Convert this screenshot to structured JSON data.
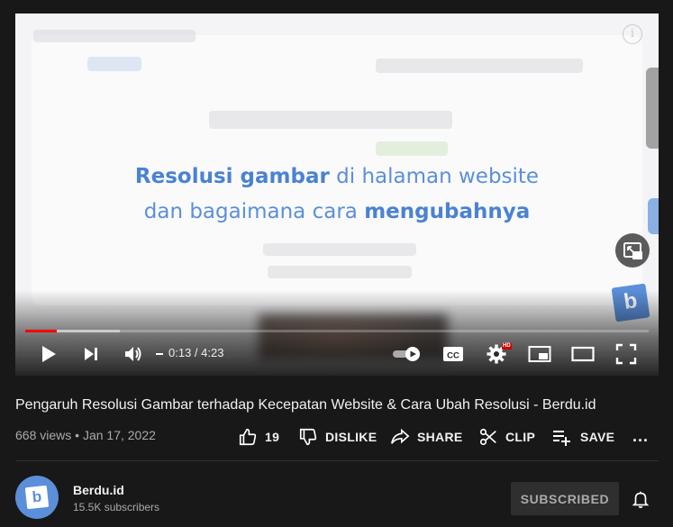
{
  "player": {
    "overlay": {
      "line1_bold": "Resolusi gambar",
      "line1_rest": " di halaman website",
      "line2_rest": "dan bagaimana cara ",
      "line2_bold": "mengubahnya"
    },
    "brand_badge": "b",
    "progress": {
      "played_fraction": 0.051,
      "loaded_fraction": 0.152
    },
    "time": {
      "current": "0:13",
      "duration": "4:23",
      "separator": " / "
    },
    "hd_badge": "HD",
    "icons": {
      "play": "play-icon",
      "next": "next-icon",
      "volume": "volume-icon",
      "autoplay": "autoplay-toggle-icon",
      "captions": "cc-icon",
      "settings": "gear-icon",
      "miniplayer": "miniplayer-icon",
      "theater": "theater-icon",
      "fullscreen": "fullscreen-icon",
      "info": "info-icon"
    },
    "cc_label": "CC",
    "info_glyph": "i"
  },
  "video": {
    "title": "Pengaruh Resolusi Gambar terhadap Kecepatan Website & Cara Ubah Resolusi - Berdu.id",
    "views": "668 views",
    "date": "Jan 17, 2022",
    "meta_separator": " • "
  },
  "actions": {
    "like_count": "19",
    "dislike": "DISLIKE",
    "share": "SHARE",
    "clip": "CLIP",
    "save": "SAVE",
    "more": "..."
  },
  "channel": {
    "avatar_letter": "b",
    "name": "Berdu.id",
    "subscribers": "15.5K subscribers",
    "subscribe_label": "SUBSCRIBED"
  },
  "colors": {
    "background": "#181818",
    "progress_played": "#ff0000",
    "brand_blue": "#5b8fd9",
    "subscribed_bg": "#2f2f2f"
  }
}
